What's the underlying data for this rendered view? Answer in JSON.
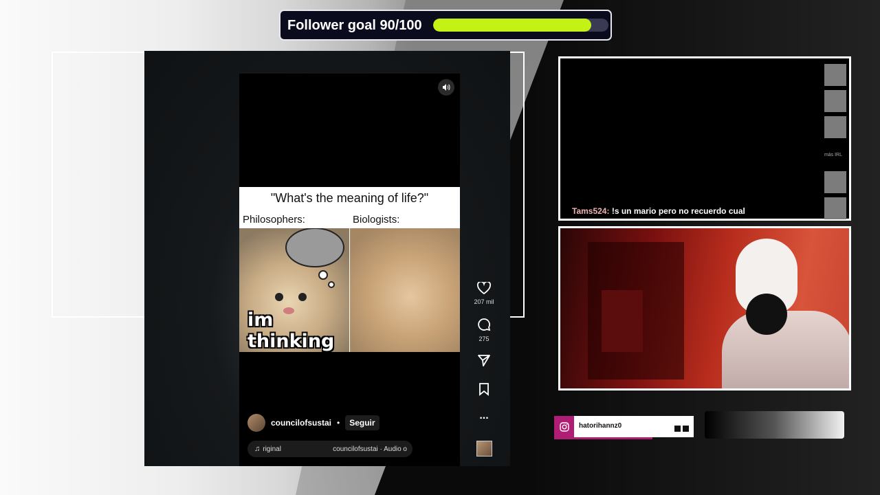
{
  "follower_goal": {
    "label": "Follower goal 90/100",
    "current": 90,
    "target": 100,
    "progress_fraction": 0.9,
    "fill_color": "#c5f215"
  },
  "tiktok": {
    "meme": {
      "title": "\"What's the meaning of life?\"",
      "left_label": "Philosophers:",
      "right_label": "Biologists:",
      "caption": "im thinking"
    },
    "actions": {
      "like": {
        "icon": "heart-icon",
        "count": "207 mil"
      },
      "comment": {
        "icon": "comment-icon",
        "count": "275"
      },
      "share": {
        "icon": "share-icon"
      },
      "save": {
        "icon": "bookmark-icon"
      },
      "more": {
        "icon": "more-icon",
        "label": "..."
      }
    },
    "author": {
      "name": "councilofsustai",
      "separator": "•",
      "follow_label": "Seguir"
    },
    "audio": {
      "left": "riginal",
      "right": "councilofsustai · Audio o"
    }
  },
  "chat": {
    "side_label": "más IRL",
    "message": {
      "user": "Tams524:",
      "text": " !s un mario pero no recuerdo cual"
    }
  },
  "instagram": {
    "handle": "hatorihannz0",
    "accent": "#b01d74"
  }
}
